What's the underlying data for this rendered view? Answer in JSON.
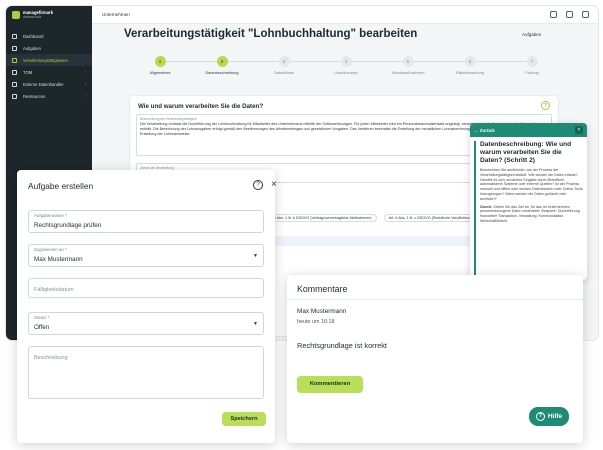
{
  "sidebar": {
    "logo_line1": "managefirmark",
    "logo_line2": "datenschutz",
    "items": [
      {
        "label": "Dashboard"
      },
      {
        "label": "Aufgaben"
      },
      {
        "label": "Verarbeitungstätigkeiten"
      },
      {
        "label": "TOM"
      },
      {
        "label": "Externe Datenhandler"
      },
      {
        "label": "Ressourcen"
      }
    ],
    "active_item": "Verarbeitungstätigkeiten"
  },
  "topbar": {
    "company": "Unternehmen"
  },
  "page": {
    "title": "Verarbeitungstätigkeit \"Lohnbuchhaltung\" bearbeiten",
    "tasks_link": "Aufgaben"
  },
  "stepper": {
    "steps": [
      {
        "num": "1",
        "label": "Allgemeines",
        "done": true
      },
      {
        "num": "2",
        "label": "Datenbeschreibung",
        "done": true
      },
      {
        "num": "3",
        "label": "Datenflüsse",
        "done": false
      },
      {
        "num": "4",
        "label": "Löschkonzept",
        "done": false
      },
      {
        "num": "5",
        "label": "Schutzmaßnahmen",
        "done": false
      },
      {
        "num": "6",
        "label": "Risikobewertung",
        "done": false
      },
      {
        "num": "7",
        "label": "Prüfung",
        "done": false
      }
    ]
  },
  "question": {
    "title": "Wie und warum verarbeiten Sie die Daten?",
    "description_label": "Beschreibung der Verarbeitungstätigkeit",
    "description": "Die Verarbeitung umfasst die Durchführung der Lohnbuchhaltung für Mitarbeiter des Unternehmens mithilfe der Softwarelösungen. Für jeden Mitarbeiter wird ein Personalstammdatensatz angelegt, verwaltet, das sämtliche relevanten Informationen enthält. Die Berechnung der Lohnausgaben erfolgt gemäß den Bestimmungen des Arbeitsvertrages und gesetzlichen Vorgaben. Das Verfahren beinhaltet die Erstellung der monatlichen Lohnabrechnungen durch die Finanzbuchhaltung und die Erstellung der Lohnnachweise.",
    "purpose_label": "Zweck der Verarbeitung",
    "chip1": "Art. 6 Abs. 1 lit. b DSGVO (Vertrag/vorvertragliche Maßnahmen)",
    "chip2": "Art. 6 Abs. 1 lit. c DSGVO (Rechtliche Verpflichtung)"
  },
  "wizard": {
    "back": "← Zurück",
    "close": "×",
    "title": "Datenbeschreibung: Wie und warum verarbeiten Sie die Daten? (Schritt 2)",
    "text": "Beschreiben Sie ausführlich, wie der Prozess der Verarbeitungstätigkeit abläuft. Wie werden die Daten erfasst? Handelt es sich um direkte Eingabe durch Betroffene, automatisierte Systeme oder externe Quellen? Ist der Prozess manuell und offline oder werden Datenbanken oder Online-Tools hinzugezogen? Wann werden die Daten gelöscht oder archiviert?",
    "hint_label": "Zweck:",
    "hint": "Geben Sie das Ziel an, für das Ihr Unternehmen personenbezogene Daten verarbeitet. Beispiele: Durchführung finanzieller Transaktion, Verwaltung, Kommunikation, Wirtschaftlichkeit."
  },
  "task_dialog": {
    "title": "Aufgabe erstellen",
    "help_icon": "?",
    "close_icon": "×",
    "name_label": "Aufgabenname *",
    "name_value": "Rechtsgrundlage prüfen",
    "assignee_label": "Zugewiesen an *",
    "assignee_value": "Max Mustermann",
    "due_placeholder": "Fälligkeitsdatum",
    "status_label": "Status *",
    "status_value": "Offen",
    "description_placeholder": "Beschreibung",
    "save": "Speichern"
  },
  "comments": {
    "title": "Kommentare",
    "author": "Max Mustermann",
    "time": "heute um 16:18",
    "text": "Rechtsgrundlage ist korrekt",
    "button": "Kommentieren"
  },
  "help_fab": {
    "label": "Hilfe",
    "icon": "?"
  },
  "colors": {
    "accent": "#b9de57",
    "teal": "#1f8a76",
    "sidebar": "#1d262b"
  }
}
